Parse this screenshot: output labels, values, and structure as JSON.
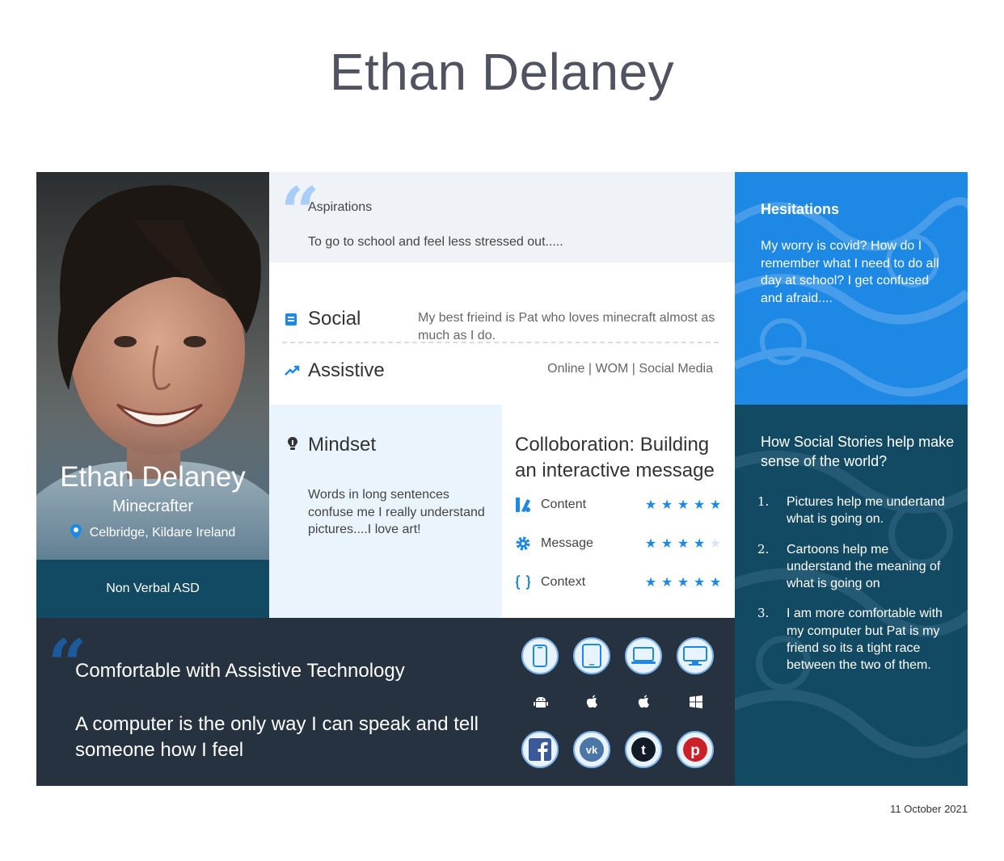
{
  "page": {
    "title": "Ethan Delaney",
    "date": "11 October 2021"
  },
  "profile": {
    "name": "Ethan Delaney",
    "role": "Minecrafter",
    "location": "Celbridge, Kildare Ireland",
    "tag": "Non Verbal ASD"
  },
  "aspirations": {
    "title": "Aspirations",
    "text": "To go to school and feel less stressed out....."
  },
  "social": {
    "label": "Social",
    "text": "My best frieind is Pat who loves minecraft almost as much as I do."
  },
  "assistive": {
    "label": "Assistive",
    "text": "Online | WOM | Social Media"
  },
  "hesitations": {
    "title": "Hesitations",
    "text": "My worry is covid? How do I remember what I need to do all day at school? I get confused and afraid...."
  },
  "mindset": {
    "label": "Mindset",
    "text": "Words in long sentences confuse me I really understand pictures....I love art!"
  },
  "collaboration": {
    "title": "Colloboration: Building an interactive message",
    "ratings": [
      {
        "label": "Content",
        "icon": "content-icon",
        "stars": 5,
        "max": 5
      },
      {
        "label": "Message",
        "icon": "gear-icon",
        "stars": 4,
        "max": 5
      },
      {
        "label": "Context",
        "icon": "braces-icon",
        "stars": 5,
        "max": 5
      }
    ]
  },
  "stories": {
    "title": "How Social Stories help make sense of the world?",
    "items": [
      {
        "num": "1.",
        "text": "Pictures help me undertand what is going on."
      },
      {
        "num": "2.",
        "text": "Cartoons help me understand the meaning of what is going on"
      },
      {
        "num": "3.",
        "text": "I am more comfortable with my computer but Pat is my friend so its a tight race between the two of them."
      }
    ]
  },
  "bottom": {
    "title": "Comfortable with Assistive Technology",
    "text": "A computer is the only way I can speak and tell someone how I feel"
  },
  "devices": [
    "phone-icon",
    "tablet-icon",
    "laptop-icon",
    "desktop-icon"
  ],
  "platforms": [
    "android-icon",
    "apple-icon",
    "apple-icon",
    "windows-icon"
  ],
  "social_networks": [
    "facebook-icon",
    "vk-icon",
    "tumblr-icon",
    "pinterest-icon"
  ],
  "colors": {
    "accent": "#1e88e5",
    "dark_teal": "#134a63",
    "navy": "#263240",
    "light_panel": "#eff3f7",
    "light_blue": "#eaf4fd"
  }
}
